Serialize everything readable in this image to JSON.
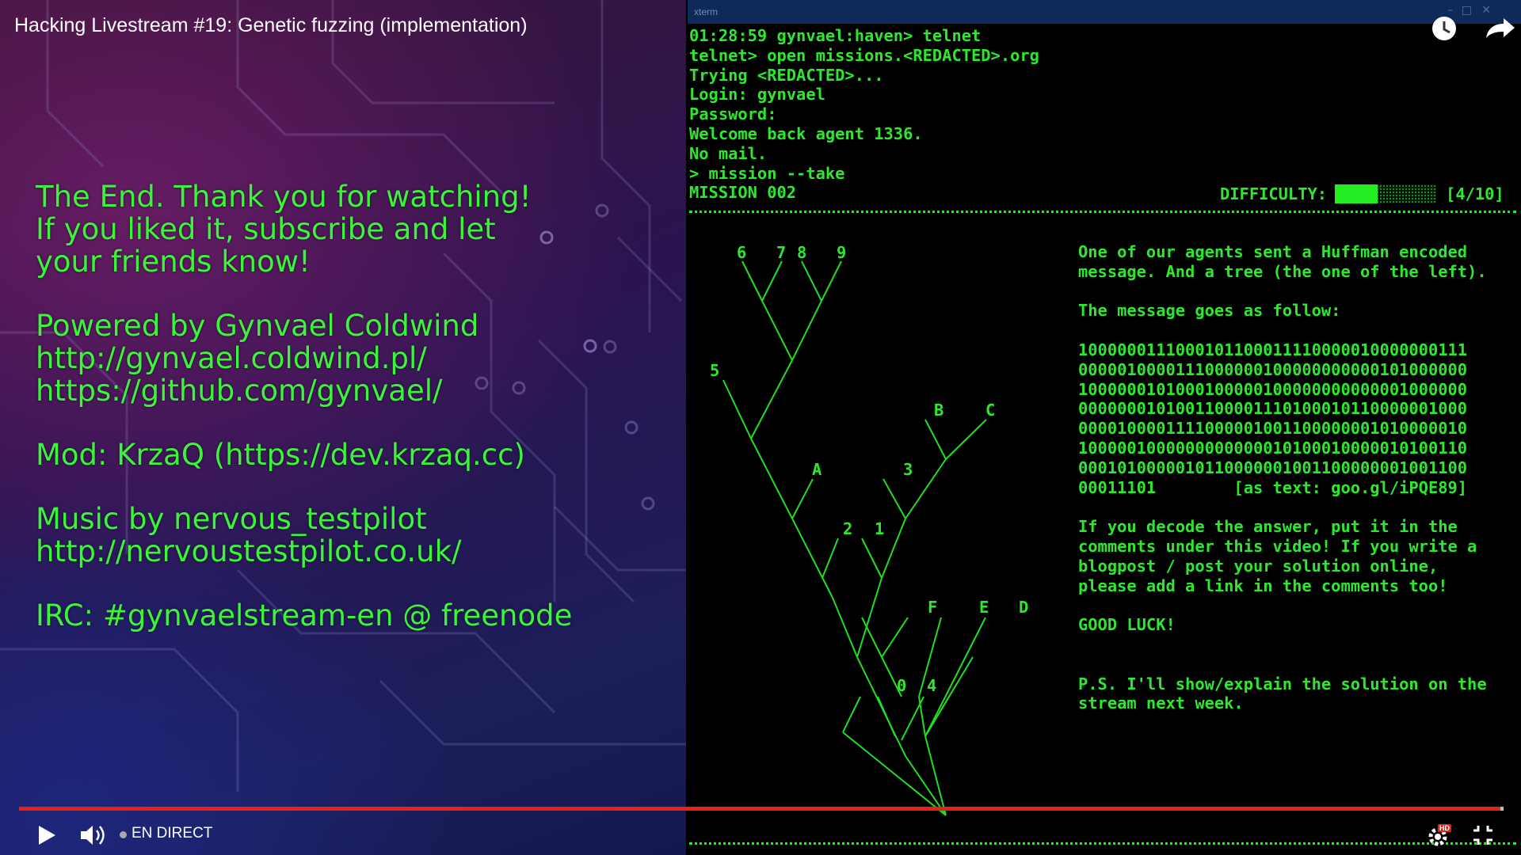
{
  "player": {
    "title": "Hacking Livestream #19: Genetic fuzzing (implementation)",
    "live_label": "EN DIRECT",
    "hd_badge": "HD",
    "progress_pct": 100,
    "accent_color": "#e62117",
    "icons": [
      "clock-icon",
      "share-icon",
      "play-icon",
      "volume-icon",
      "settings-icon",
      "exit-fullscreen-icon"
    ]
  },
  "slide": {
    "text_color": "#3bf53b",
    "blocks": [
      [
        "The End. Thank you for watching!",
        "If you liked it, subscribe and let",
        "your friends know!"
      ],
      [
        "Powered by Gynvael Coldwind",
        "http://gynvael.coldwind.pl/",
        "https://github.com/gynvael/"
      ],
      [
        "Mod: KrzaQ (https://dev.krzaq.cc)"
      ],
      [
        "Music by nervous_testpilot",
        "http://nervoustestpilot.co.uk/"
      ],
      [
        "IRC: #gynvaelstream-en @ freenode"
      ]
    ]
  },
  "terminal": {
    "window_title": "xterm",
    "text_color": "#2ee82e",
    "session": [
      "01:28:59 gynvael:haven> telnet",
      "telnet> open missions.<REDACTED>.org",
      "Trying <REDACTED>...",
      "Login: gynvael",
      "Password:",
      "Welcome back agent 1336.",
      "No mail.",
      "> mission --take",
      "MISSION 002"
    ],
    "difficulty": {
      "label": "DIFFICULTY:",
      "value": 4,
      "max": 10,
      "text": "[4/10]"
    },
    "tree_labels": [
      "6",
      "7",
      "8",
      "9",
      "5",
      "B",
      "C",
      "A",
      "3",
      "2",
      "1",
      "F",
      "E",
      "D",
      "0",
      "4"
    ],
    "message": [
      "One of our agents sent a Huffman encoded",
      "message. And a tree (the one of the left).",
      "",
      "The message goes as follow:",
      "",
      "1000000111000101100011110000010000000111",
      "0000010000111000000100000000000101000000",
      "1000000101000100000100000000000001000000",
      "0000000101001100001110100010110000001000",
      "0000100001111000001001100000001010000010",
      "1000001000000000000010100010000010100110",
      "0001010000010110000001001100000001001100",
      "00011101        [as text: goo.gl/iPQE89]",
      "",
      "If you decode the answer, put it in the",
      "comments under this video! If you write a",
      "blogpost / post your solution online,",
      "please add a link in the comments too!",
      "",
      "GOOD LUCK!",
      "",
      "",
      "P.S. I'll show/explain the solution on the",
      "stream next week."
    ]
  }
}
